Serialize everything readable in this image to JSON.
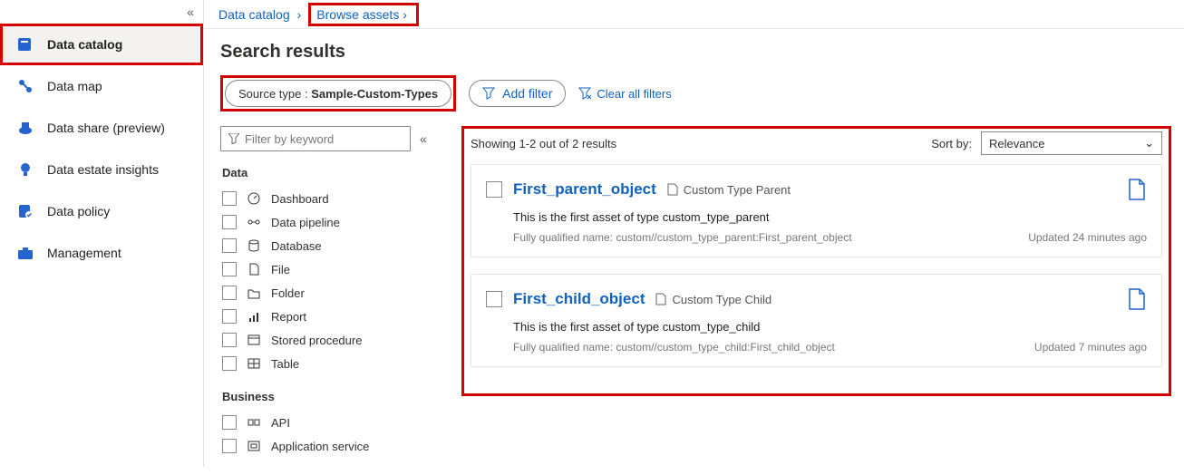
{
  "nav": {
    "items": [
      {
        "label": "Data catalog",
        "active": true
      },
      {
        "label": "Data map"
      },
      {
        "label": "Data share (preview)"
      },
      {
        "label": "Data estate insights"
      },
      {
        "label": "Data policy"
      },
      {
        "label": "Management"
      }
    ]
  },
  "breadcrumb": {
    "root": "Data catalog",
    "current": "Browse assets"
  },
  "page_title": "Search results",
  "applied_filter": {
    "key": "Source type",
    "value": "Sample-Custom-Types"
  },
  "add_filter_label": "Add filter",
  "clear_filters_label": "Clear all filters",
  "filter_input_placeholder": "Filter by keyword",
  "facets": {
    "group1_title": "Data",
    "group1_items": [
      "Dashboard",
      "Data pipeline",
      "Database",
      "File",
      "Folder",
      "Report",
      "Stored procedure",
      "Table"
    ],
    "group2_title": "Business",
    "group2_items": [
      "API",
      "Application service"
    ]
  },
  "results_bar": {
    "count_text": "Showing 1-2 out of 2 results",
    "sort_label": "Sort by:",
    "sort_value": "Relevance"
  },
  "results": [
    {
      "title": "First_parent_object",
      "type": "Custom Type Parent",
      "desc": "This is the first asset of type custom_type_parent",
      "fqn": "Fully qualified name: custom//custom_type_parent:First_parent_object",
      "updated": "Updated 24 minutes ago"
    },
    {
      "title": "First_child_object",
      "type": "Custom Type Child",
      "desc": "This is the first asset of type custom_type_child",
      "fqn": "Fully qualified name: custom//custom_type_child:First_child_object",
      "updated": "Updated 7 minutes ago"
    }
  ]
}
